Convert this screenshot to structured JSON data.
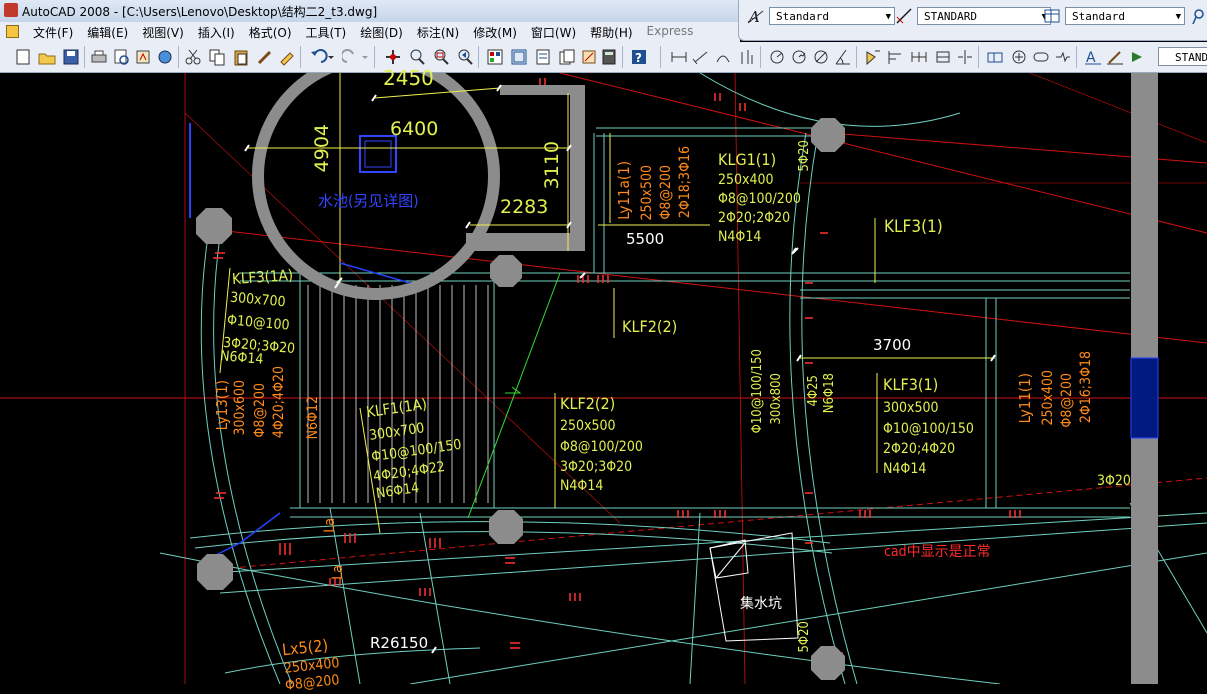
{
  "window": {
    "title": "AutoCAD 2008 - [C:\\Users\\Lenovo\\Desktop\\结构二2_t3.dwg]"
  },
  "menu": [
    "文件(F)",
    "编辑(E)",
    "视图(V)",
    "插入(I)",
    "格式(O)",
    "工具(T)",
    "绘图(D)",
    "标注(N)",
    "修改(M)",
    "窗口(W)",
    "帮助(H)",
    "Express"
  ],
  "styles": {
    "text_style": "Standard",
    "dim_style": "STANDARD",
    "table_style": "Standard",
    "multileader_style": "STAND"
  },
  "drawing": {
    "dims": {
      "d2450": "2450",
      "d6400": "6400",
      "d4904": "4904",
      "d3110": "3110",
      "d2283": "2283",
      "d5500": "5500",
      "d3700": "3700",
      "r26150": "R26150"
    },
    "pool_note": "水池(另见详图)",
    "sump_note": "集水坑",
    "red_note": "cad中显示是正常",
    "beams": {
      "ly11a": {
        "name": "Ly11a(1)",
        "size": "250x500",
        "stirrup": "Φ8@200",
        "bars": "2Φ18;3Φ16"
      },
      "klg1": {
        "name": "KLG1(1)",
        "size": "250x400",
        "stirrup": "Φ8@100/200",
        "bars": "2Φ20;2Φ20",
        "tie": "N4Φ14"
      },
      "klf3_top": {
        "name": "KLF3(1)"
      },
      "klf3_1a": {
        "name": "KLF3(1A)",
        "size": "300x700",
        "stirrup": "Φ10@100",
        "bars": "3Φ20;3Φ20",
        "tie": "N6Φ14"
      },
      "klf2_top": {
        "name": "KLF2(2)"
      },
      "ly13": {
        "name": "Ly13(1)",
        "size": "300x600",
        "stirrup": "Φ8@200",
        "bars": "4Φ20;4Φ20"
      },
      "n6_12": "N6Φ12",
      "klf1": {
        "name": "KLF1(1A)",
        "size": "300x700",
        "stirrup": "Φ10@100/150",
        "bars": "4Φ20;4Φ22",
        "tie": "N6Φ14"
      },
      "klf2": {
        "name": "KLF2(2)",
        "size": "250x500",
        "stirrup": "Φ8@100/200",
        "bars": "3Φ20;3Φ20",
        "tie": "N4Φ14"
      },
      "vert_mid": {
        "stirrup": "Φ10@100/150",
        "size": "300x800",
        "bars": "4Φ25",
        "tie": "N6Φ18"
      },
      "klf3_mid": {
        "name": "KLF3(1)",
        "size": "300x500",
        "stirrup": "Φ10@100/150",
        "bars": "2Φ20;4Φ20",
        "tie": "N4Φ14"
      },
      "ly11": {
        "name": "Ly11(1)",
        "size": "250x400",
        "stirrup": "Φ8@200",
        "bars": "2Φ16;3Φ18"
      },
      "bar_3_20": "3Φ20",
      "bar_5_20_top": "5Φ20",
      "bar_5_20_bot": "5Φ20",
      "lx5": {
        "name": "Lx5(2)",
        "size": "250x400",
        "stirrup": "Φ8@200"
      },
      "la1": "La",
      "la2": "La"
    }
  },
  "colors": {
    "background": "#000000",
    "beam_text": "#e0f050",
    "secondary_text": "#ff8a1a",
    "pool_text": "#3344ff",
    "note_text": "#ff2a2a",
    "column_fill": "#8c8c8c"
  }
}
